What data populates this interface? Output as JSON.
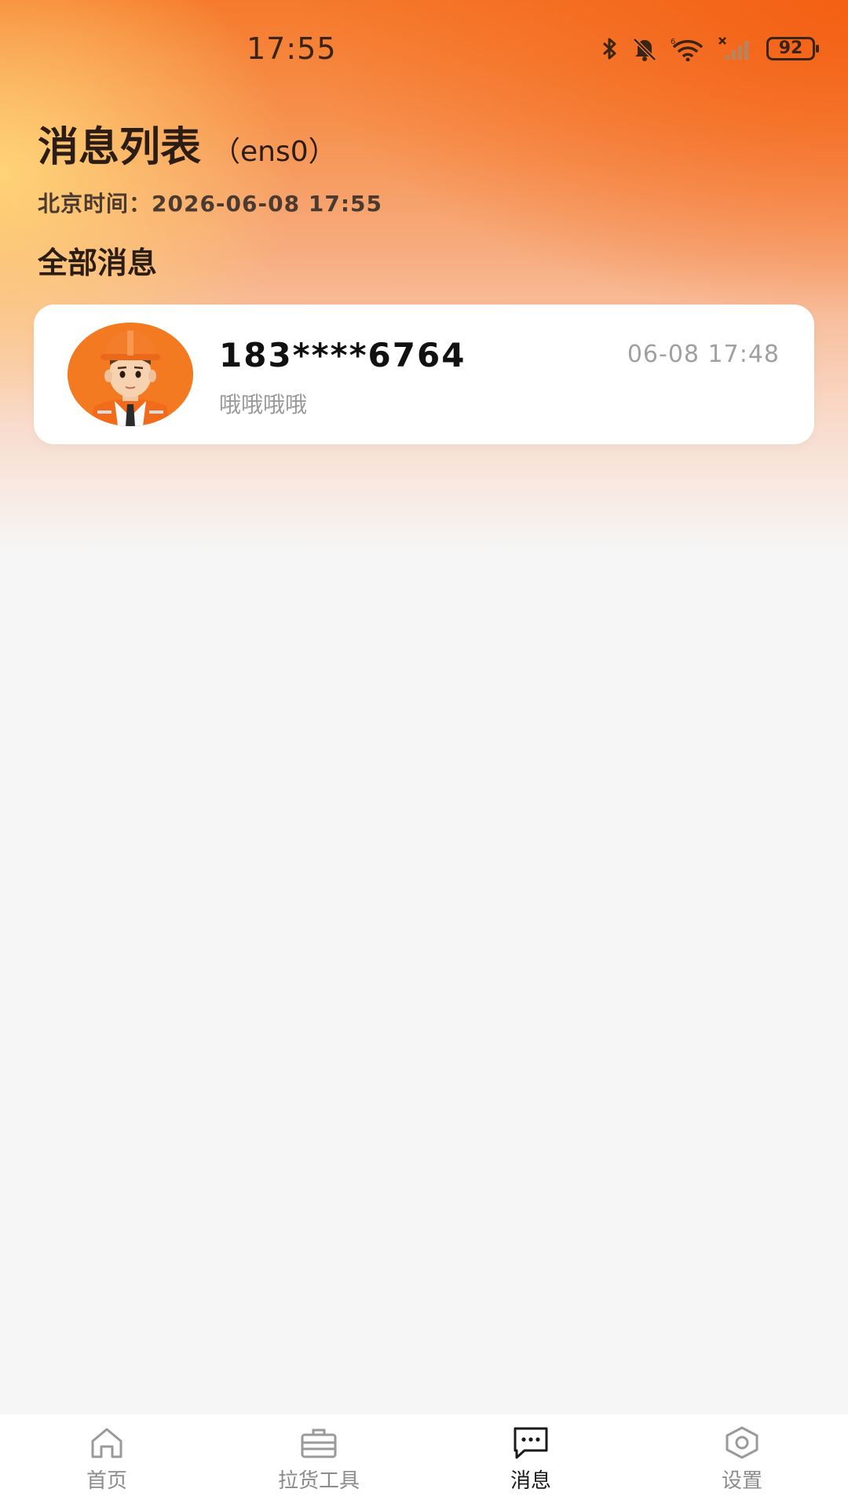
{
  "status_bar": {
    "time": "17:55",
    "battery": "92",
    "icons": [
      "bluetooth-icon",
      "mute-bell-icon",
      "wifi-icon",
      "signal-icon",
      "battery-icon"
    ]
  },
  "header": {
    "title": "消息列表",
    "subtitle": "（ens0）",
    "beijing_time": "北京时间：2026-06-08 17:55"
  },
  "section": {
    "title": "全部消息"
  },
  "messages": [
    {
      "name": "183****6764",
      "preview": "哦哦哦哦",
      "time": "06-08 17:48",
      "avatar": "worker-avatar"
    }
  ],
  "tabbar": {
    "tabs": [
      {
        "label": "首页",
        "icon": "home-icon"
      },
      {
        "label": "拉货工具",
        "icon": "toolbox-icon"
      },
      {
        "label": "消息",
        "icon": "message-icon"
      },
      {
        "label": "设置",
        "icon": "settings-icon"
      }
    ],
    "active_index": 2
  },
  "colors": {
    "header_orange": "#f57a2c",
    "background": "#f6f6f6",
    "card_bg": "#ffffff"
  }
}
